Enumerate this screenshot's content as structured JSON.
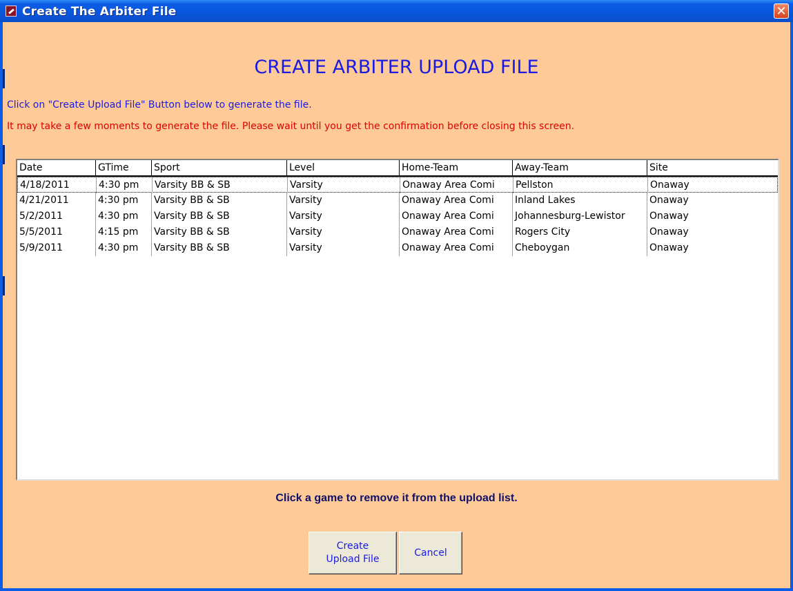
{
  "window": {
    "title": "Create The Arbiter File",
    "close_glyph": "✕"
  },
  "heading": "CREATE ARBITER UPLOAD FILE",
  "instructions": {
    "line1": "Click on \"Create Upload File\" Button below to generate the file.",
    "line2": "It may take a few moments to generate the file.  Please wait until you get the confirmation before closing this screen."
  },
  "grid": {
    "columns": [
      "Date",
      "GTime",
      "Sport",
      "Level",
      "Home-Team",
      "Away-Team",
      "Site"
    ],
    "rows": [
      [
        "4/18/2011",
        "4:30 pm",
        "Varsity BB & SB",
        "Varsity",
        "Onaway Area Comi",
        "Pellston",
        "Onaway"
      ],
      [
        "4/21/2011",
        "4:30 pm",
        "Varsity BB & SB",
        "Varsity",
        "Onaway Area Comi",
        "Inland Lakes",
        "Onaway"
      ],
      [
        "5/2/2011",
        "4:30 pm",
        "Varsity BB & SB",
        "Varsity",
        "Onaway Area Comi",
        "Johannesburg-Lewistor",
        "Onaway"
      ],
      [
        "5/5/2011",
        "4:15 pm",
        "Varsity BB & SB",
        "Varsity",
        "Onaway Area Comi",
        "Rogers City",
        "Onaway"
      ],
      [
        "5/9/2011",
        "4:30 pm",
        "Varsity BB & SB",
        "Varsity",
        "Onaway Area Comi",
        "Cheboygan",
        "Onaway"
      ]
    ]
  },
  "hint": "Click a game to remove it from the upload list.",
  "buttons": {
    "create_line1": "Create",
    "create_line2": "Upload File",
    "cancel": "Cancel"
  },
  "colors": {
    "background": "#fecb98",
    "titlebar": "#0b5ce6",
    "heading_text": "#1a1ae0",
    "warning_text": "#e00000"
  },
  "icons": {
    "title_icon": "app-key-icon",
    "close": "close-icon"
  }
}
